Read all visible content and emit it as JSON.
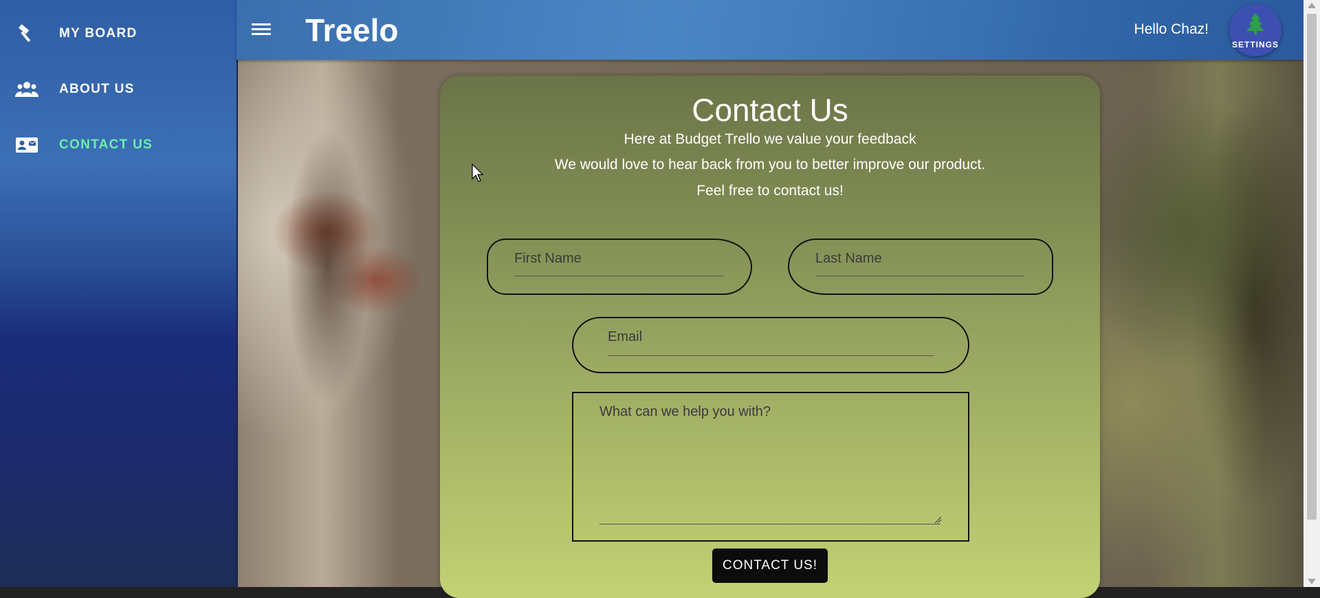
{
  "sidebar": {
    "items": [
      {
        "label": "MY BOARD",
        "icon": "hammer-icon"
      },
      {
        "label": "ABOUT US",
        "icon": "people-icon"
      },
      {
        "label": "CONTACT US",
        "icon": "contact-card-icon",
        "active": true
      }
    ]
  },
  "header": {
    "logo": "Treelo",
    "greeting": "Hello Chaz!",
    "settings_label": "SETTINGS",
    "settings_icon": "tree-icon"
  },
  "contact": {
    "title": "Contact Us",
    "lines": [
      "Here at Budget Trello we value your feedback",
      "We would love to hear back from you to better improve our product.",
      "Feel free to contact us!"
    ],
    "first_name_placeholder": "First Name",
    "last_name_placeholder": "Last Name",
    "email_placeholder": "Email",
    "message_placeholder": "What can we help you with?",
    "submit_label": "CONTACT US!"
  },
  "colors": {
    "active_nav": "#69f0ae",
    "settings_button": "#3d4fb0"
  }
}
